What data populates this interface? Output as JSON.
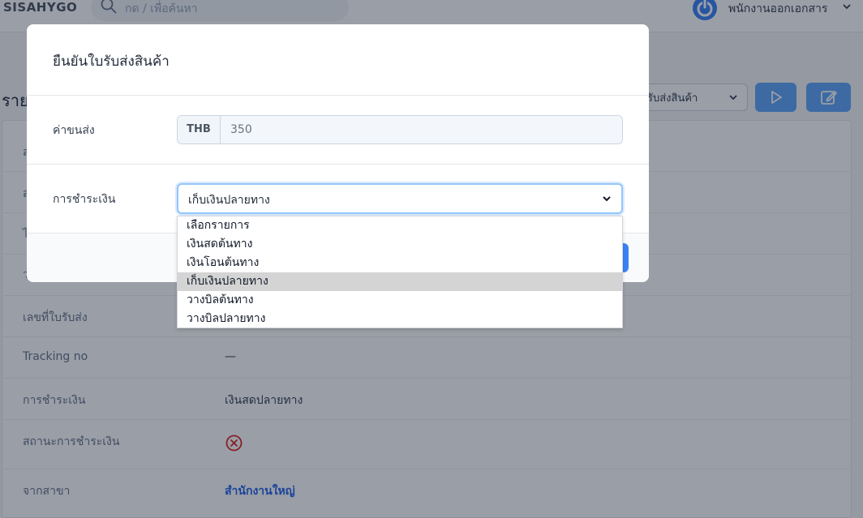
{
  "app": {
    "brand": "SISAHYGO",
    "search_placeholder": "กด / เพื่อค้นหา",
    "user_name": "พนักงานออกเอกสาร",
    "user_chevron": "⌄"
  },
  "page": {
    "title_partial": "ราย",
    "doc_type_select": "รับส่งสินค้า",
    "fields": [
      {
        "label": "เลขที่ใบรับส่ง",
        "value": ""
      },
      {
        "label": "Tracking no",
        "value": "—"
      },
      {
        "label": "การชำระเงิน",
        "value": "เงินสดปลายทาง"
      },
      {
        "label": "สถานะการชำระเงิน",
        "value": ""
      },
      {
        "label": "จากสาขา",
        "value": "สำนักงานใหญ่"
      }
    ],
    "partial_labels": [
      "ส",
      "ส",
      "ไ",
      "ว"
    ]
  },
  "modal": {
    "title": "ยืนยันใบรับส่งสินค้า",
    "shipping_label": "ค่าขนส่ง",
    "currency": "THB",
    "shipping_value": "350",
    "payment_label": "การชำระเงิน",
    "payment_selected": "เก็บเงินปลายทาง"
  },
  "dropdown": {
    "options": [
      "เลือกรายการ",
      "เงินสดต้นทาง",
      "เงินโอนต้นทาง",
      "เก็บเงินปลายทาง",
      "วางบิลต้นทาง",
      "วางบิลปลายทาง"
    ],
    "selected_index": 3
  },
  "colors": {
    "accent": "#3b82f6",
    "error": "#dc2626",
    "link": "#2563eb"
  }
}
